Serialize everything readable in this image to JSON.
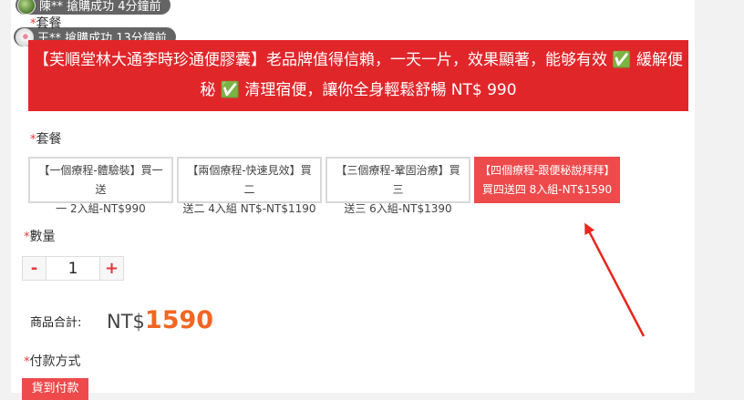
{
  "toasts": [
    {
      "text": "陳** 搶購成功 4分鐘前"
    },
    {
      "text": "王** 搶購成功 13分鐘前"
    }
  ],
  "top_partial_label": "套餐",
  "banner": {
    "line1": "【芙順堂林大通李時珍通便膠囊】老品牌值得信賴，一天一片，效果顯著，能够有效 ✅ 緩解便",
    "line2": "秘 ✅ 清理宿便，讓你全身輕鬆舒暢 NT$ 990"
  },
  "package_section": {
    "label": "套餐",
    "options": [
      {
        "line1": "【一個療程-體驗裝】買一送",
        "line2": "一 2入組-NT$990"
      },
      {
        "line1": "【兩個療程-快速見效】買二",
        "line2": "送二 4入組 NT$-NT$1190"
      },
      {
        "line1": "【三個療程-鞏固治療】買三",
        "line2": "送三 6入組-NT$1390"
      },
      {
        "line1": "【四個療程-跟便秘說拜拜】",
        "line2": "買四送四 8入組-NT$1590"
      }
    ],
    "selected_index": 3
  },
  "quantity": {
    "label": "數量",
    "minus": "-",
    "value": "1",
    "plus": "+"
  },
  "total": {
    "label": "商品合計:",
    "currency": "NT$",
    "amount": "1590"
  },
  "payment": {
    "label": "付款方式",
    "option": "貨到付款"
  },
  "colors": {
    "accent": "#e1262a",
    "selected": "#ee4a4c",
    "price": "#f26522",
    "annotation_arrow": "#e8261d"
  }
}
